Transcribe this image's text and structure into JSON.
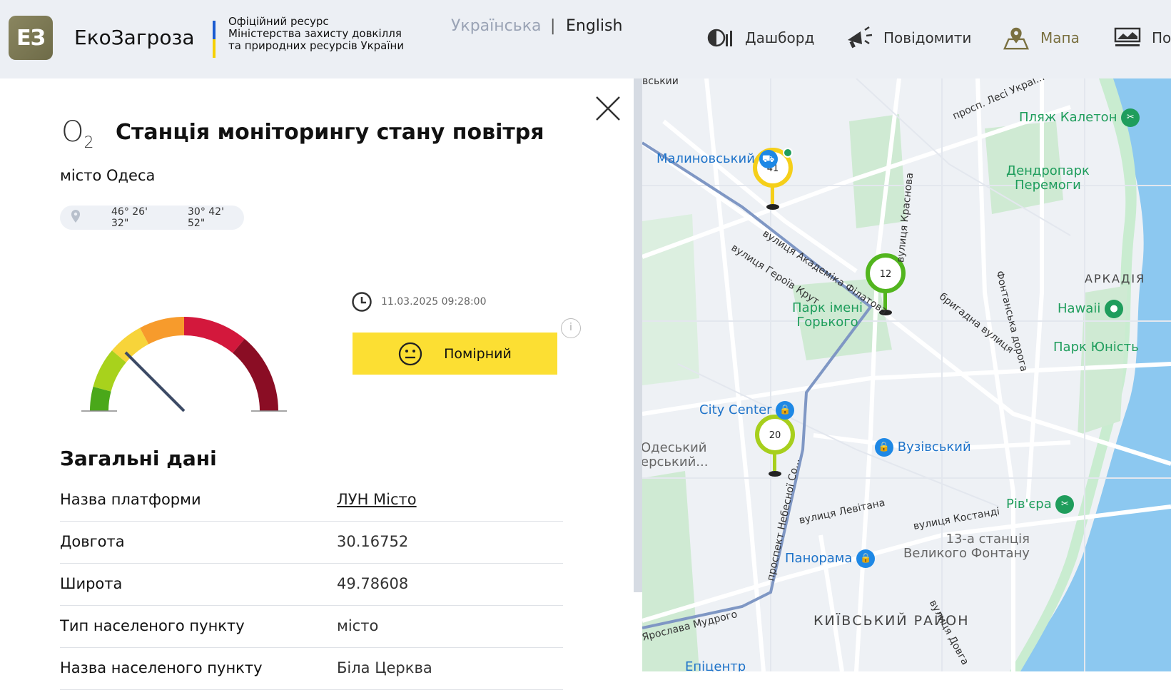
{
  "header": {
    "logo_text": "ЕЗ",
    "brand": "ЕкоЗагроза",
    "official_lines": [
      "Офіційний ресурс",
      "Міністерства захисту довкілля",
      "та природних ресурсів України"
    ],
    "lang_ua": "Українська",
    "lang_sep": "|",
    "lang_en": "English",
    "nav": [
      {
        "label": "Дашборд",
        "icon": "dashboard-icon"
      },
      {
        "label": "Повідомити",
        "icon": "megaphone-icon"
      },
      {
        "label": "Мапа",
        "icon": "map-icon"
      },
      {
        "label": "По",
        "icon": "monitor-icon"
      }
    ],
    "active_color": "#7a7040"
  },
  "panel": {
    "o2_symbol": "O",
    "o2_sub": "2",
    "title": "Станція моніторингу стану повітря",
    "city": "місто Одеса",
    "lat_dms": "46° 26' 32\"",
    "lon_dms": "30° 42' 52\"",
    "timestamp": "11.03.2025 09:28:00",
    "status_label": "Помірний",
    "status_color": "#fcdf33",
    "info_icon": "i",
    "gauge_level": 0.25,
    "general_title": "Загальні дані",
    "rows": [
      {
        "key": "Назва платформи",
        "value": "ЛУН Місто",
        "link": true
      },
      {
        "key": "Довгота",
        "value": "30.16752"
      },
      {
        "key": "Широта",
        "value": "49.78608"
      },
      {
        "key": "Тип населеного пункту",
        "value": "місто"
      },
      {
        "key": "Назва населеного пункту",
        "value": "Біла Церква"
      }
    ]
  },
  "map": {
    "pois": [
      {
        "label": "Малиновський",
        "kind": "shop"
      },
      {
        "label": "Пляж Калетон",
        "kind": "green"
      },
      {
        "label": "Дендропарк\nПеремоги",
        "kind": "green-text"
      },
      {
        "label": "Парк імені\nГорького",
        "kind": "green-text"
      },
      {
        "label": "АРКАДІЯ",
        "kind": "district"
      },
      {
        "label": "Hawaii",
        "kind": "green"
      },
      {
        "label": "Парк Юність",
        "kind": "green"
      },
      {
        "label": "City Center",
        "kind": "shop"
      },
      {
        "label": "Вузівський",
        "kind": "shop"
      },
      {
        "label": "Одеський\nерський...",
        "kind": "gray"
      },
      {
        "label": "Рів'єра",
        "kind": "green"
      },
      {
        "label": "Панорама",
        "kind": "shop"
      },
      {
        "label": "13-а станція\nВеликого Фонтану",
        "kind": "gray"
      },
      {
        "label": "КИЇВСЬКИЙ\nРАЙОН",
        "kind": "district"
      },
      {
        "label": "Епіцентр",
        "kind": "shop"
      }
    ],
    "streets": [
      "вулиця Академіка Філатова",
      "вулиця Героїв Крут",
      "вулиця Краснова",
      "просп. Лесі Украї...",
      "Фонтанська дорога",
      "бригадна вулиця",
      "вулиця Левітана",
      "вулиця Костанді",
      "проспект Небесної Со...",
      "Ярослава Мудрого",
      "вулиця Довга",
      "вський"
    ],
    "markers": [
      {
        "value": "41",
        "color": "#f5cf1a",
        "stem": "#f5cf1a"
      },
      {
        "value": "12",
        "color": "#52b51e",
        "stem": "#52b51e"
      },
      {
        "value": "20",
        "color": "#a7cf1d",
        "stem": "#a7cf1d"
      }
    ]
  }
}
